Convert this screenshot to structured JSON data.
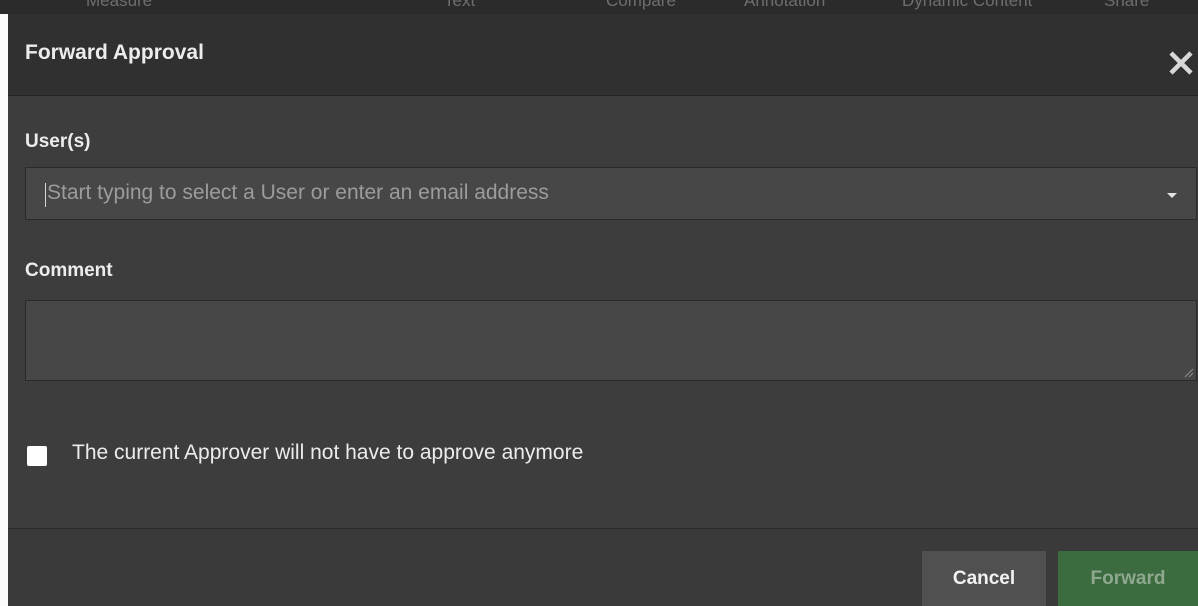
{
  "background_toolbar": {
    "items": [
      "Measure",
      "Text",
      "Compare",
      "Annotation",
      "Dynamic Content",
      "Share"
    ]
  },
  "dialog": {
    "title": "Forward Approval",
    "close_icon": "close-icon"
  },
  "users_field": {
    "label": "User(s)",
    "placeholder": "Start typing to select a User or enter an email address",
    "value": "",
    "dropdown_icon": "caret-down-icon"
  },
  "comment_field": {
    "label": "Comment",
    "value": ""
  },
  "checkbox": {
    "label": "The current Approver will not have to approve anymore",
    "checked": false
  },
  "footer": {
    "cancel_label": "Cancel",
    "forward_label": "Forward"
  },
  "colors": {
    "dialog_bg": "#3d3d3d",
    "header_bg": "#303030",
    "input_bg": "#474747",
    "forward_button": "#3c6b3f",
    "cancel_button": "#505050"
  }
}
